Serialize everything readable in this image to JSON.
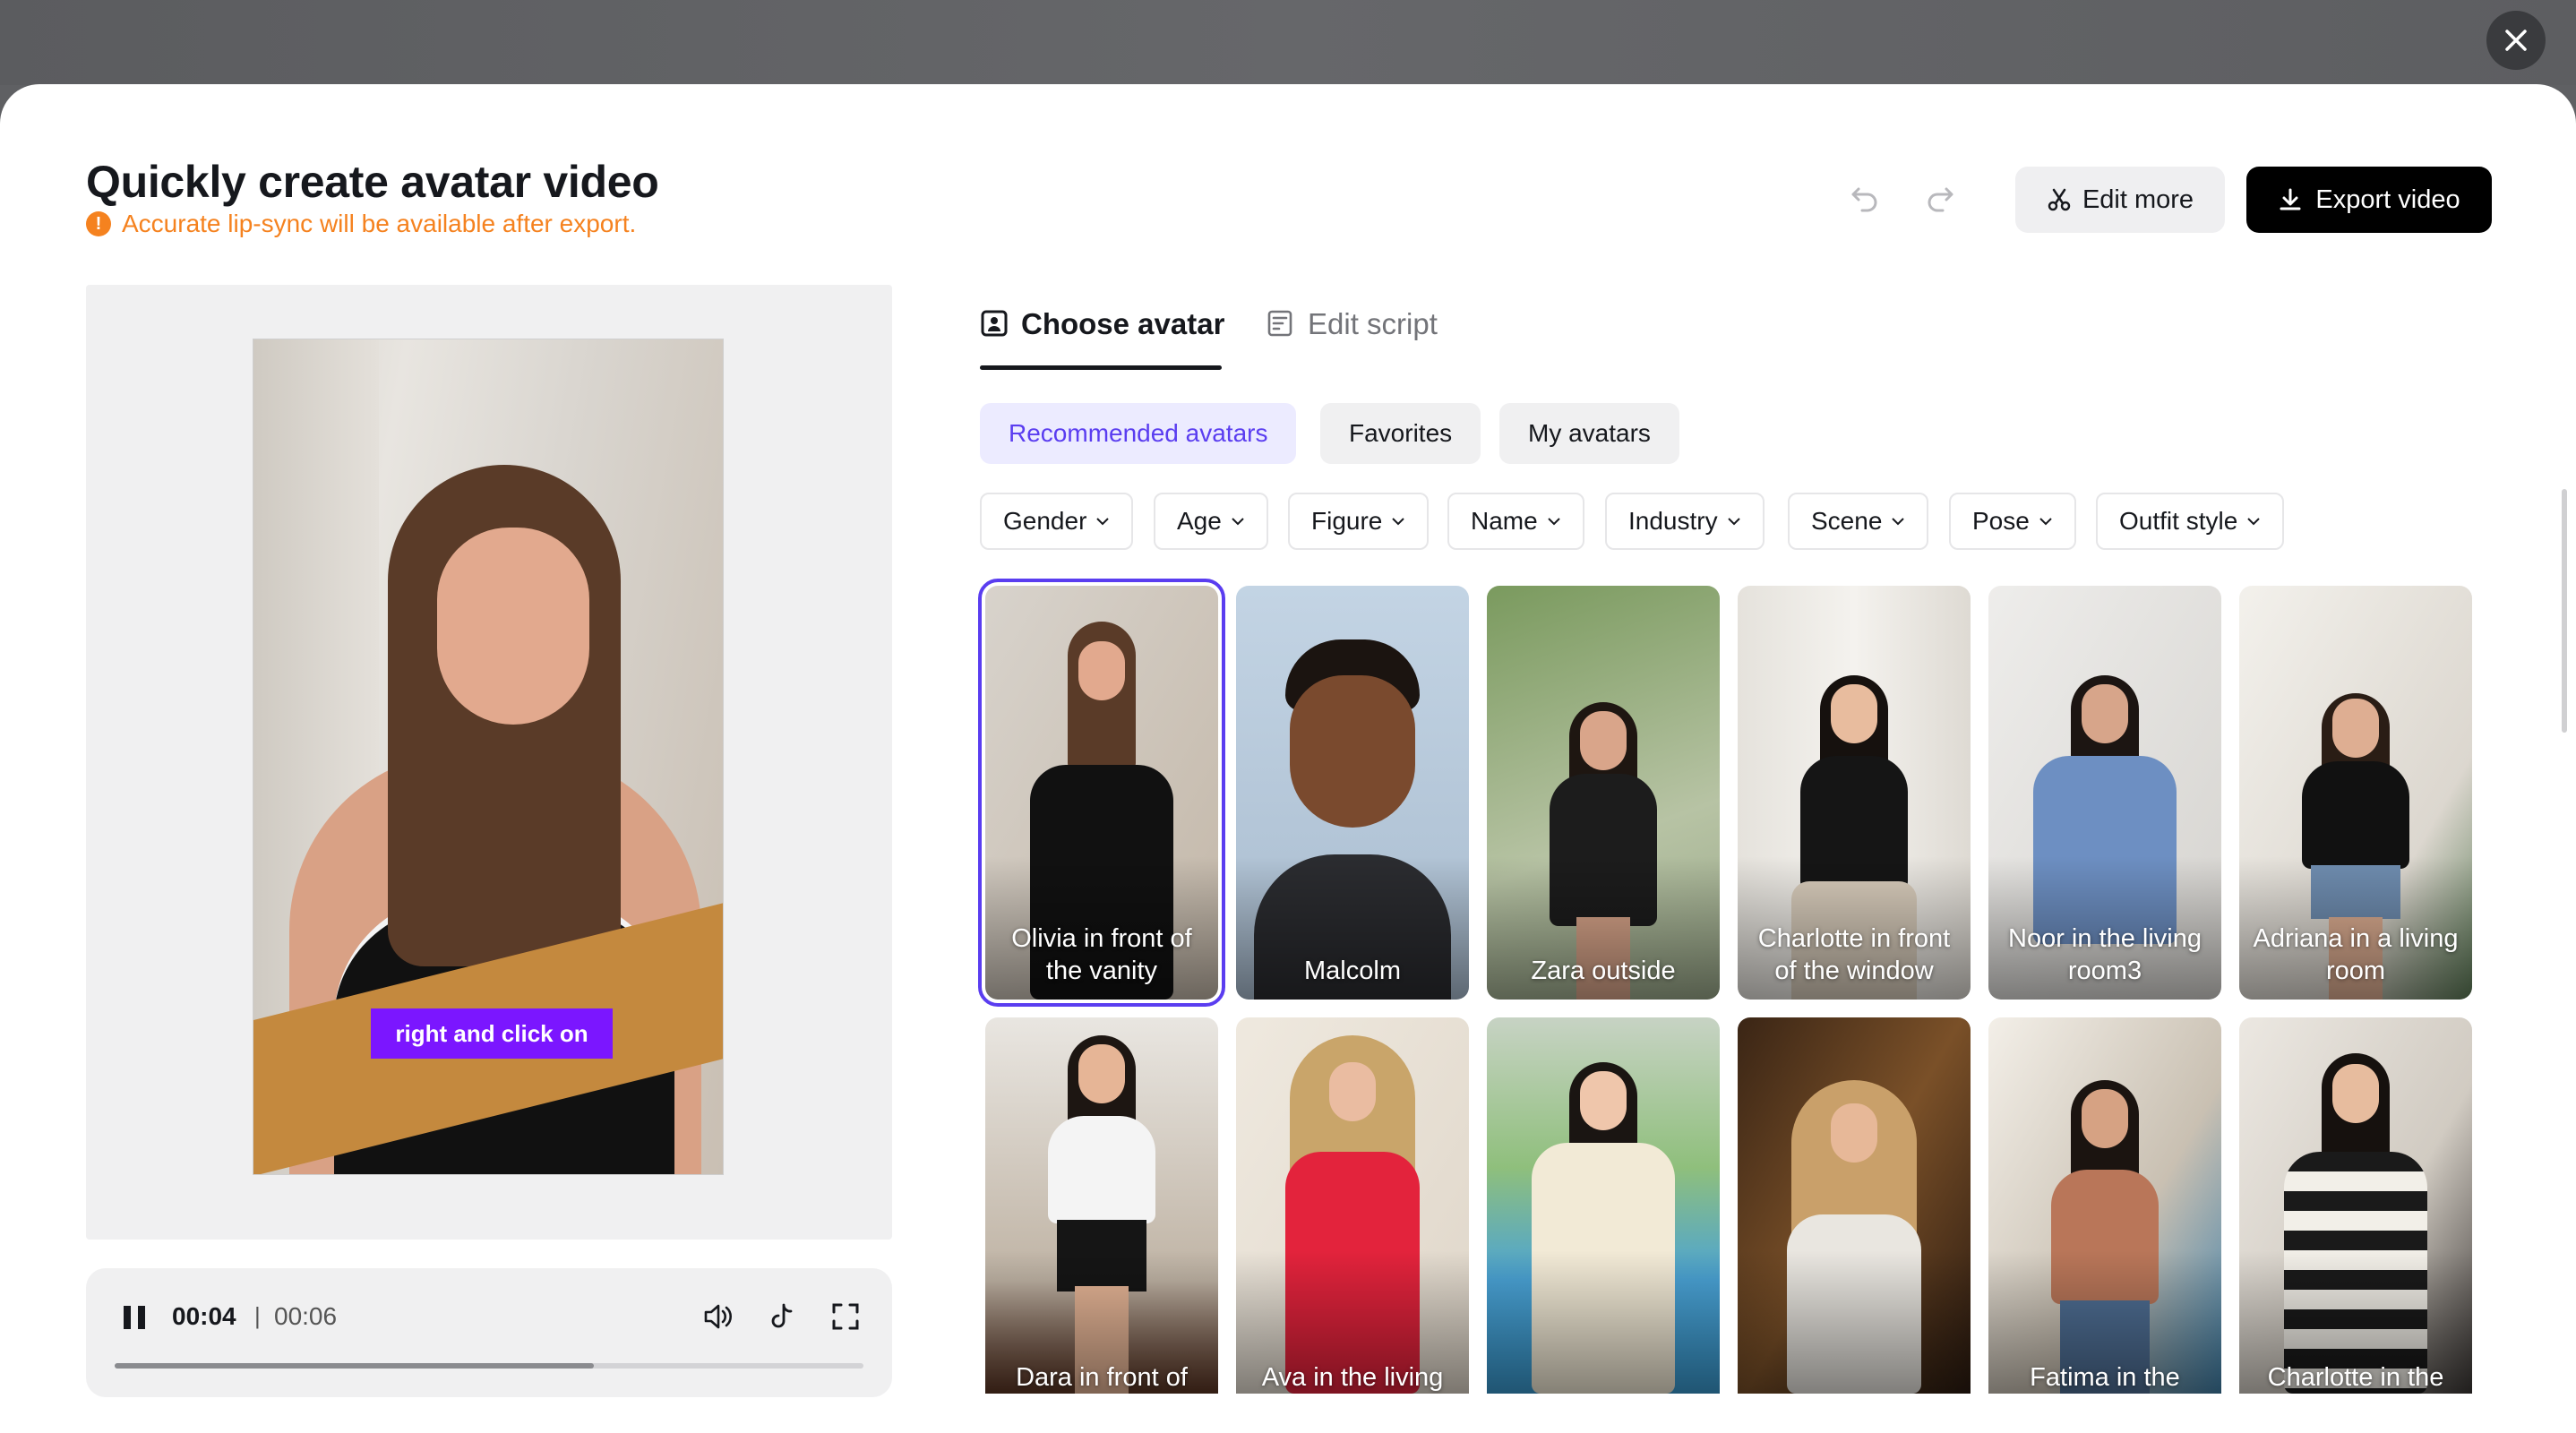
{
  "header": {
    "title": "Quickly create avatar video",
    "notice": "Accurate lip-sync will be available after export.",
    "notice_icon": "exclamation-icon",
    "edit_more_label": "Edit more",
    "export_label": "Export video"
  },
  "preview": {
    "caption": "right and click on",
    "time_current": "00:04",
    "time_separator": "|",
    "time_total": "00:06",
    "progress": 0.64
  },
  "tabs": [
    {
      "label": "Choose avatar",
      "icon": "avatar-icon",
      "active": true
    },
    {
      "label": "Edit script",
      "icon": "script-icon",
      "active": false
    }
  ],
  "categories": [
    {
      "label": "Recommended avatars",
      "active": true
    },
    {
      "label": "Favorites",
      "active": false
    },
    {
      "label": "My avatars",
      "active": false
    }
  ],
  "filters": [
    "Gender",
    "Age",
    "Figure",
    "Name",
    "Industry",
    "Scene",
    "Pose",
    "Outfit style"
  ],
  "avatars_row1": [
    "Olivia in front of the vanity",
    "Malcolm",
    "Zara outside",
    "Charlotte in front of the window",
    "Noor in the living room3",
    "Adriana in a living room"
  ],
  "avatars_row2": [
    "Dara in front of",
    "Ava in the living",
    "",
    "",
    "Fatima in the",
    "Charlotte in the"
  ],
  "colors": {
    "accent": "#5a3df0",
    "warning": "#f5821f",
    "caption_bg": "#7b16ff"
  }
}
